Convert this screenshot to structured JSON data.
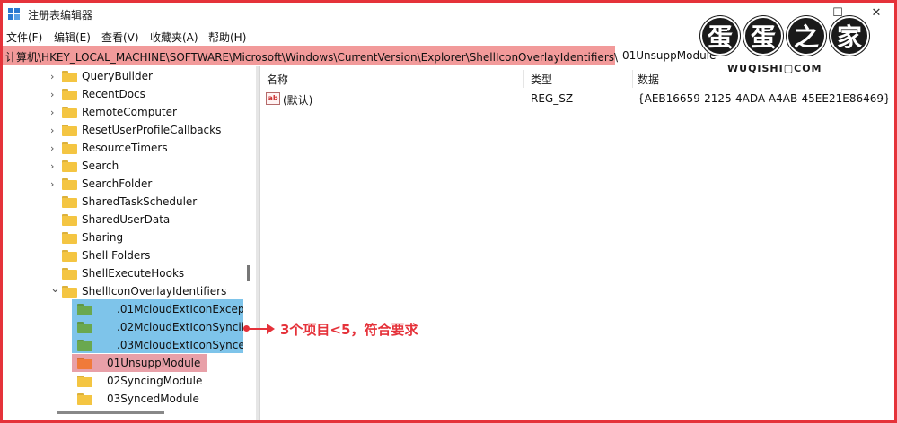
{
  "window": {
    "title": "注册表编辑器",
    "minimize_glyph": "—",
    "maximize_glyph": "☐",
    "close_glyph": "✕"
  },
  "menu": [
    {
      "label": "文件(F)"
    },
    {
      "label": "编辑(E)"
    },
    {
      "label": "查看(V)"
    },
    {
      "label": "收藏夹(A)"
    },
    {
      "label": "帮助(H)"
    }
  ],
  "address": {
    "path": "计算机\\HKEY_LOCAL_MACHINE\\SOFTWARE\\Microsoft\\Windows\\CurrentVersion\\Explorer\\ShellIconOverlayIdentifiers\\",
    "tail": "01UnsuppModule"
  },
  "watermark": {
    "chars": [
      "蛋",
      "蛋",
      "之",
      "家"
    ],
    "sub": "WUQISHI▢COM"
  },
  "tree": [
    {
      "label": "QueryBuilder",
      "expandable": true,
      "level": 0
    },
    {
      "label": "RecentDocs",
      "expandable": true,
      "level": 0
    },
    {
      "label": "RemoteComputer",
      "expandable": true,
      "level": 0
    },
    {
      "label": "ResetUserProfileCallbacks",
      "expandable": true,
      "level": 0
    },
    {
      "label": "ResourceTimers",
      "expandable": true,
      "level": 0
    },
    {
      "label": "Search",
      "expandable": true,
      "level": 0
    },
    {
      "label": "SearchFolder",
      "expandable": true,
      "level": 0
    },
    {
      "label": "SharedTaskScheduler",
      "expandable": false,
      "level": 0
    },
    {
      "label": "SharedUserData",
      "expandable": false,
      "level": 0
    },
    {
      "label": "Sharing",
      "expandable": false,
      "level": 0
    },
    {
      "label": "Shell Folders",
      "expandable": false,
      "level": 0
    },
    {
      "label": "ShellExecuteHooks",
      "expandable": false,
      "level": 0
    },
    {
      "label": "ShellIconOverlayIdentifiers",
      "expandable": true,
      "expanded": true,
      "level": 0
    },
    {
      "label": ".01McloudExtIconExcep",
      "expandable": false,
      "level": 1,
      "highlight": "blue",
      "folder": "green"
    },
    {
      "label": ".02McloudExtIconSyncii",
      "expandable": false,
      "level": 1,
      "highlight": "blue",
      "folder": "green"
    },
    {
      "label": ".03McloudExtIconSynce",
      "expandable": false,
      "level": 1,
      "highlight": "blue",
      "folder": "green"
    },
    {
      "label": "01UnsuppModule",
      "expandable": false,
      "level": 1,
      "highlight": "red",
      "folder": "orange"
    },
    {
      "label": "02SyncingModule",
      "expandable": false,
      "level": 1
    },
    {
      "label": "03SyncedModule",
      "expandable": false,
      "level": 1
    }
  ],
  "columns": {
    "name": "名称",
    "type": "类型",
    "data": "数据"
  },
  "values": [
    {
      "name": "(默认)",
      "type": "REG_SZ",
      "data": "{AEB16659-2125-4ADA-A4AB-45EE21E86469}"
    }
  ],
  "annotation": {
    "text": "3个项目<5，符合要求"
  },
  "colors": {
    "frame": "#e5323a",
    "blue_highlight": "#7ec4ea",
    "red_highlight": "#e8a0a8",
    "address_highlight": "#f29a9a",
    "folder_yellow": "#f4c542",
    "folder_green": "#6aa84f",
    "folder_orange": "#f07a3a"
  }
}
